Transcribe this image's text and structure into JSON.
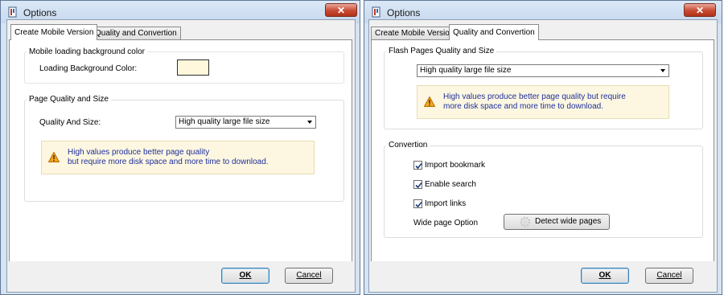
{
  "left_window": {
    "title": "Options",
    "close_symbol": "✕",
    "tabs": [
      "Create Mobile Version",
      "Quality and Convertion"
    ],
    "active_tab": 0,
    "group1": {
      "title": "Mobile loading background color",
      "label": "Loading Background Color:",
      "color": "#fff8dc"
    },
    "group2": {
      "title": "Page Quality and Size",
      "label": "Quality And Size:",
      "select_value": "High quality large file size",
      "note_line1": "High values produce better page quality",
      "note_line2": "but require more disk space and more time to download."
    },
    "ok_label": "OK",
    "cancel_label": "Cancel"
  },
  "right_window": {
    "title": "Options",
    "close_symbol": "✕",
    "tabs": [
      "Create Mobile Version",
      "Quality and Convertion"
    ],
    "active_tab": 1,
    "group1": {
      "title": "Flash Pages Quality and Size",
      "select_value": "High quality large file size",
      "note_line1": "High values produce better page quality but require",
      "note_line2": "more disk space and more time to download."
    },
    "group2": {
      "title": "Convertion",
      "checkboxes": [
        {
          "label": "Import bookmark",
          "checked": true
        },
        {
          "label": "Enable search",
          "checked": true
        },
        {
          "label": "Import links",
          "checked": true
        }
      ],
      "wide_label": "Wide page Option",
      "detect_label": "Detect wide pages"
    },
    "ok_label": "OK",
    "cancel_label": "Cancel"
  },
  "icons": {
    "app": "app-icon",
    "warning": "warning-icon",
    "detect": "gear-icon"
  },
  "colors": {
    "note_text": "#1e2f9b",
    "note_bg": "#fdf7e1",
    "close_button": "#c74b33"
  }
}
